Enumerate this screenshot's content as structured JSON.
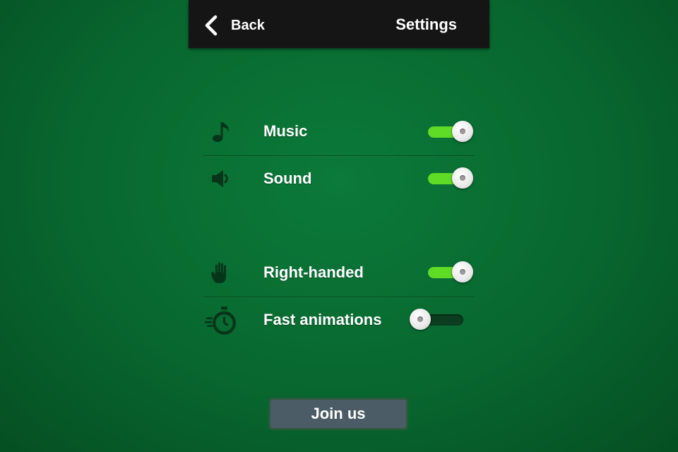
{
  "header": {
    "back_label": "Back",
    "title": "Settings"
  },
  "settings": [
    {
      "label": "Music",
      "icon": "music-note-icon",
      "enabled": true
    },
    {
      "label": "Sound",
      "icon": "speaker-icon",
      "enabled": true
    },
    {
      "label": "Right-handed",
      "icon": "hand-icon",
      "enabled": true
    },
    {
      "label": "Fast animations",
      "icon": "stopwatch-icon",
      "enabled": false
    }
  ],
  "footer": {
    "join_label": "Join us"
  },
  "colors": {
    "background": "#08672f",
    "toggle_on": "#5fdc26",
    "toggle_off": "#0b3d1f",
    "header": "#151515",
    "button": "#4b5c66"
  }
}
